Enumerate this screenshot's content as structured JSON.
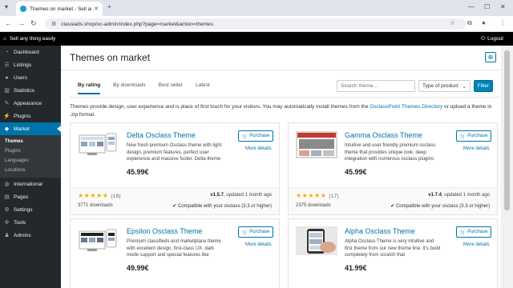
{
  "browser": {
    "tab_title": "Themes on market - Sell any thing",
    "url": "classiads.shop/oc-admin/index.php?page=market&action=themes"
  },
  "admin_bar": {
    "site_name": "Sell any thing easily",
    "logout_label": "Logout"
  },
  "sidebar": {
    "items": [
      {
        "label": "Dashboard",
        "icon": "gauge-icon"
      },
      {
        "label": "Listings",
        "icon": "list-icon"
      },
      {
        "label": "Users",
        "icon": "user-icon"
      },
      {
        "label": "Statistics",
        "icon": "chart-icon"
      },
      {
        "label": "Appearance",
        "icon": "brush-icon"
      },
      {
        "label": "Plugins",
        "icon": "plug-icon"
      },
      {
        "label": "Market",
        "icon": "cart-icon"
      },
      {
        "label": "International",
        "icon": "globe-icon"
      },
      {
        "label": "Pages",
        "icon": "page-icon"
      },
      {
        "label": "Settings",
        "icon": "gear-icon"
      },
      {
        "label": "Tools",
        "icon": "wrench-icon"
      },
      {
        "label": "Admins",
        "icon": "person-icon"
      }
    ],
    "market_sub": [
      "Themes",
      "Plugins",
      "Languages",
      "Locations"
    ]
  },
  "page": {
    "title": "Themes on market",
    "tabs": [
      "By rating",
      "By downloads",
      "Best seller",
      "Latest"
    ],
    "search_placeholder": "Search theme...",
    "type_select": "Type of product",
    "filter_label": "Filter",
    "intro": "Themes provide design, user experience and is place of first touch for your visitors. You may automatically install themes from the ",
    "intro_link": "OsclassPoint Themes Directory",
    "intro_tail": " or upload a theme in .zip format."
  },
  "cards": [
    {
      "title": "Delta Osclass Theme",
      "desc": "New fresh premium Osclass theme with light design, premium features, perfect user experience and massive footer. Delta theme",
      "price": "45.99€",
      "purchase": "Purchase",
      "more": "More details",
      "rating_count": "(18)",
      "version": "v1.5.7",
      "updated": ", updated 1 month ago",
      "downloads": "3771 downloads",
      "compat": "Compatible with your osclass (3.3 or higher)"
    },
    {
      "title": "Gamma Osclass Theme",
      "desc": "Intuitive and user friendly premium osclass theme that provides unique look, deep integration with numerous osclass plugins",
      "price": "45.99€",
      "purchase": "Purchase",
      "more": "More details",
      "rating_count": "(17)",
      "version": "v1.7.4",
      "updated": ", updated 1 month ago",
      "downloads": "2375 downloads",
      "compat": "Compatible with your osclass (3.3 or higher)"
    },
    {
      "title": "Epsilon Osclass Theme",
      "desc": "Premium classifieds and marketplace theme with excellent design, first-class UX, dark mode support and special features like",
      "price": "49.99€",
      "purchase": "Purchase",
      "more": "More details"
    },
    {
      "title": "Alpha Osclass Theme",
      "desc": "Alpha Osclass Theme is very intuitive and first theme from our new theme line. It's build completely from scratch that",
      "price": "41.99€",
      "purchase": "Purchase",
      "more": "More details"
    }
  ]
}
